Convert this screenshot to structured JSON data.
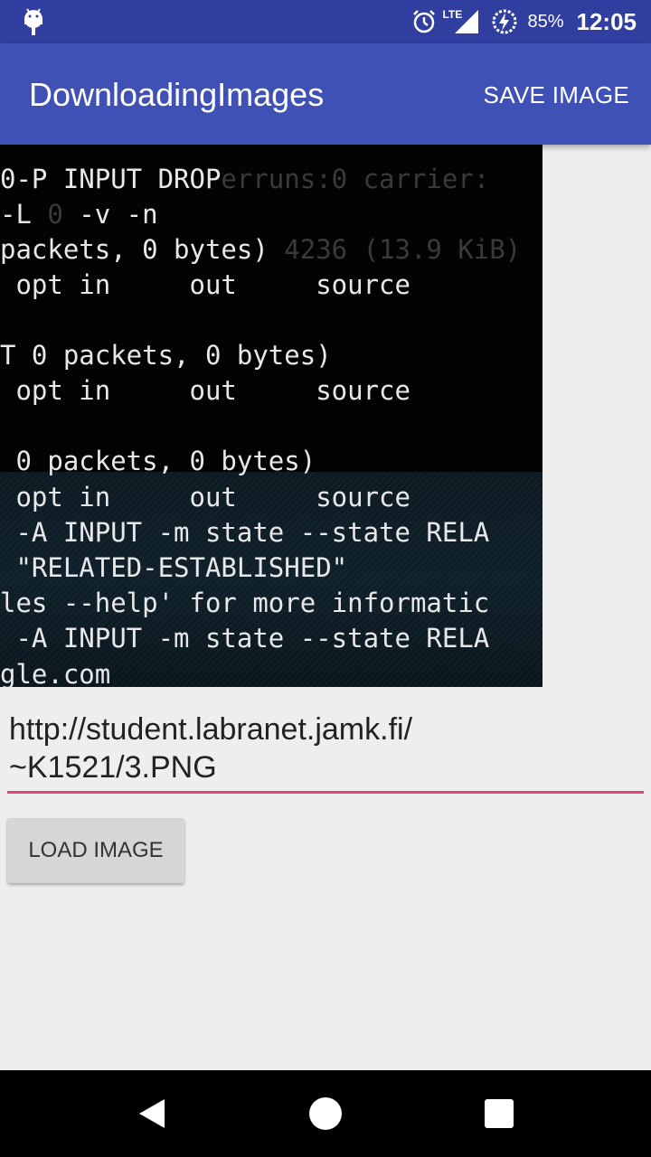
{
  "status_bar": {
    "battery_percent": "85%",
    "time": "12:05",
    "network_label": "LTE",
    "icons": [
      "android-debug-icon",
      "alarm-icon",
      "lte-signal-icon",
      "battery-charging-icon"
    ]
  },
  "app_bar": {
    "title": "DownloadingImages",
    "action_label": "SAVE IMAGE"
  },
  "image_view": {
    "terminal_lines": [
      {
        "text": "0-P INPUT DROP",
        "ghost": "              erruns:0 carrier:"
      },
      {
        "text": "-L   -v -n",
        "ghost": "   0"
      },
      {
        "text": "packets, 0 bytes)",
        "ghost": "                  4236 (13.9 KiB)"
      },
      {
        "text": " opt in     out     source"
      },
      {
        "text": "T 0 packets, 0 bytes)"
      },
      {
        "text": " opt in     out     source"
      },
      {
        "text": " 0 packets, 0 bytes)"
      },
      {
        "text": " opt in     out     source"
      },
      {
        "text": " -A INPUT -m state --state RELA"
      },
      {
        "text": " \"RELATED-ESTABLISHED\""
      },
      {
        "text": "les --help' for more informatic"
      },
      {
        "text": " -A INPUT -m state --state RELA"
      },
      {
        "text": "gle.com"
      }
    ]
  },
  "url_input": {
    "line1": "http://student.labranet.jamk.fi/",
    "line2": "~K1521/3.PNG"
  },
  "load_button": {
    "label": "LOAD IMAGE"
  },
  "colors": {
    "status_bar": "#303f9f",
    "app_bar": "#3f51b5",
    "accent": "#e0457b",
    "background": "#eeeeee"
  }
}
